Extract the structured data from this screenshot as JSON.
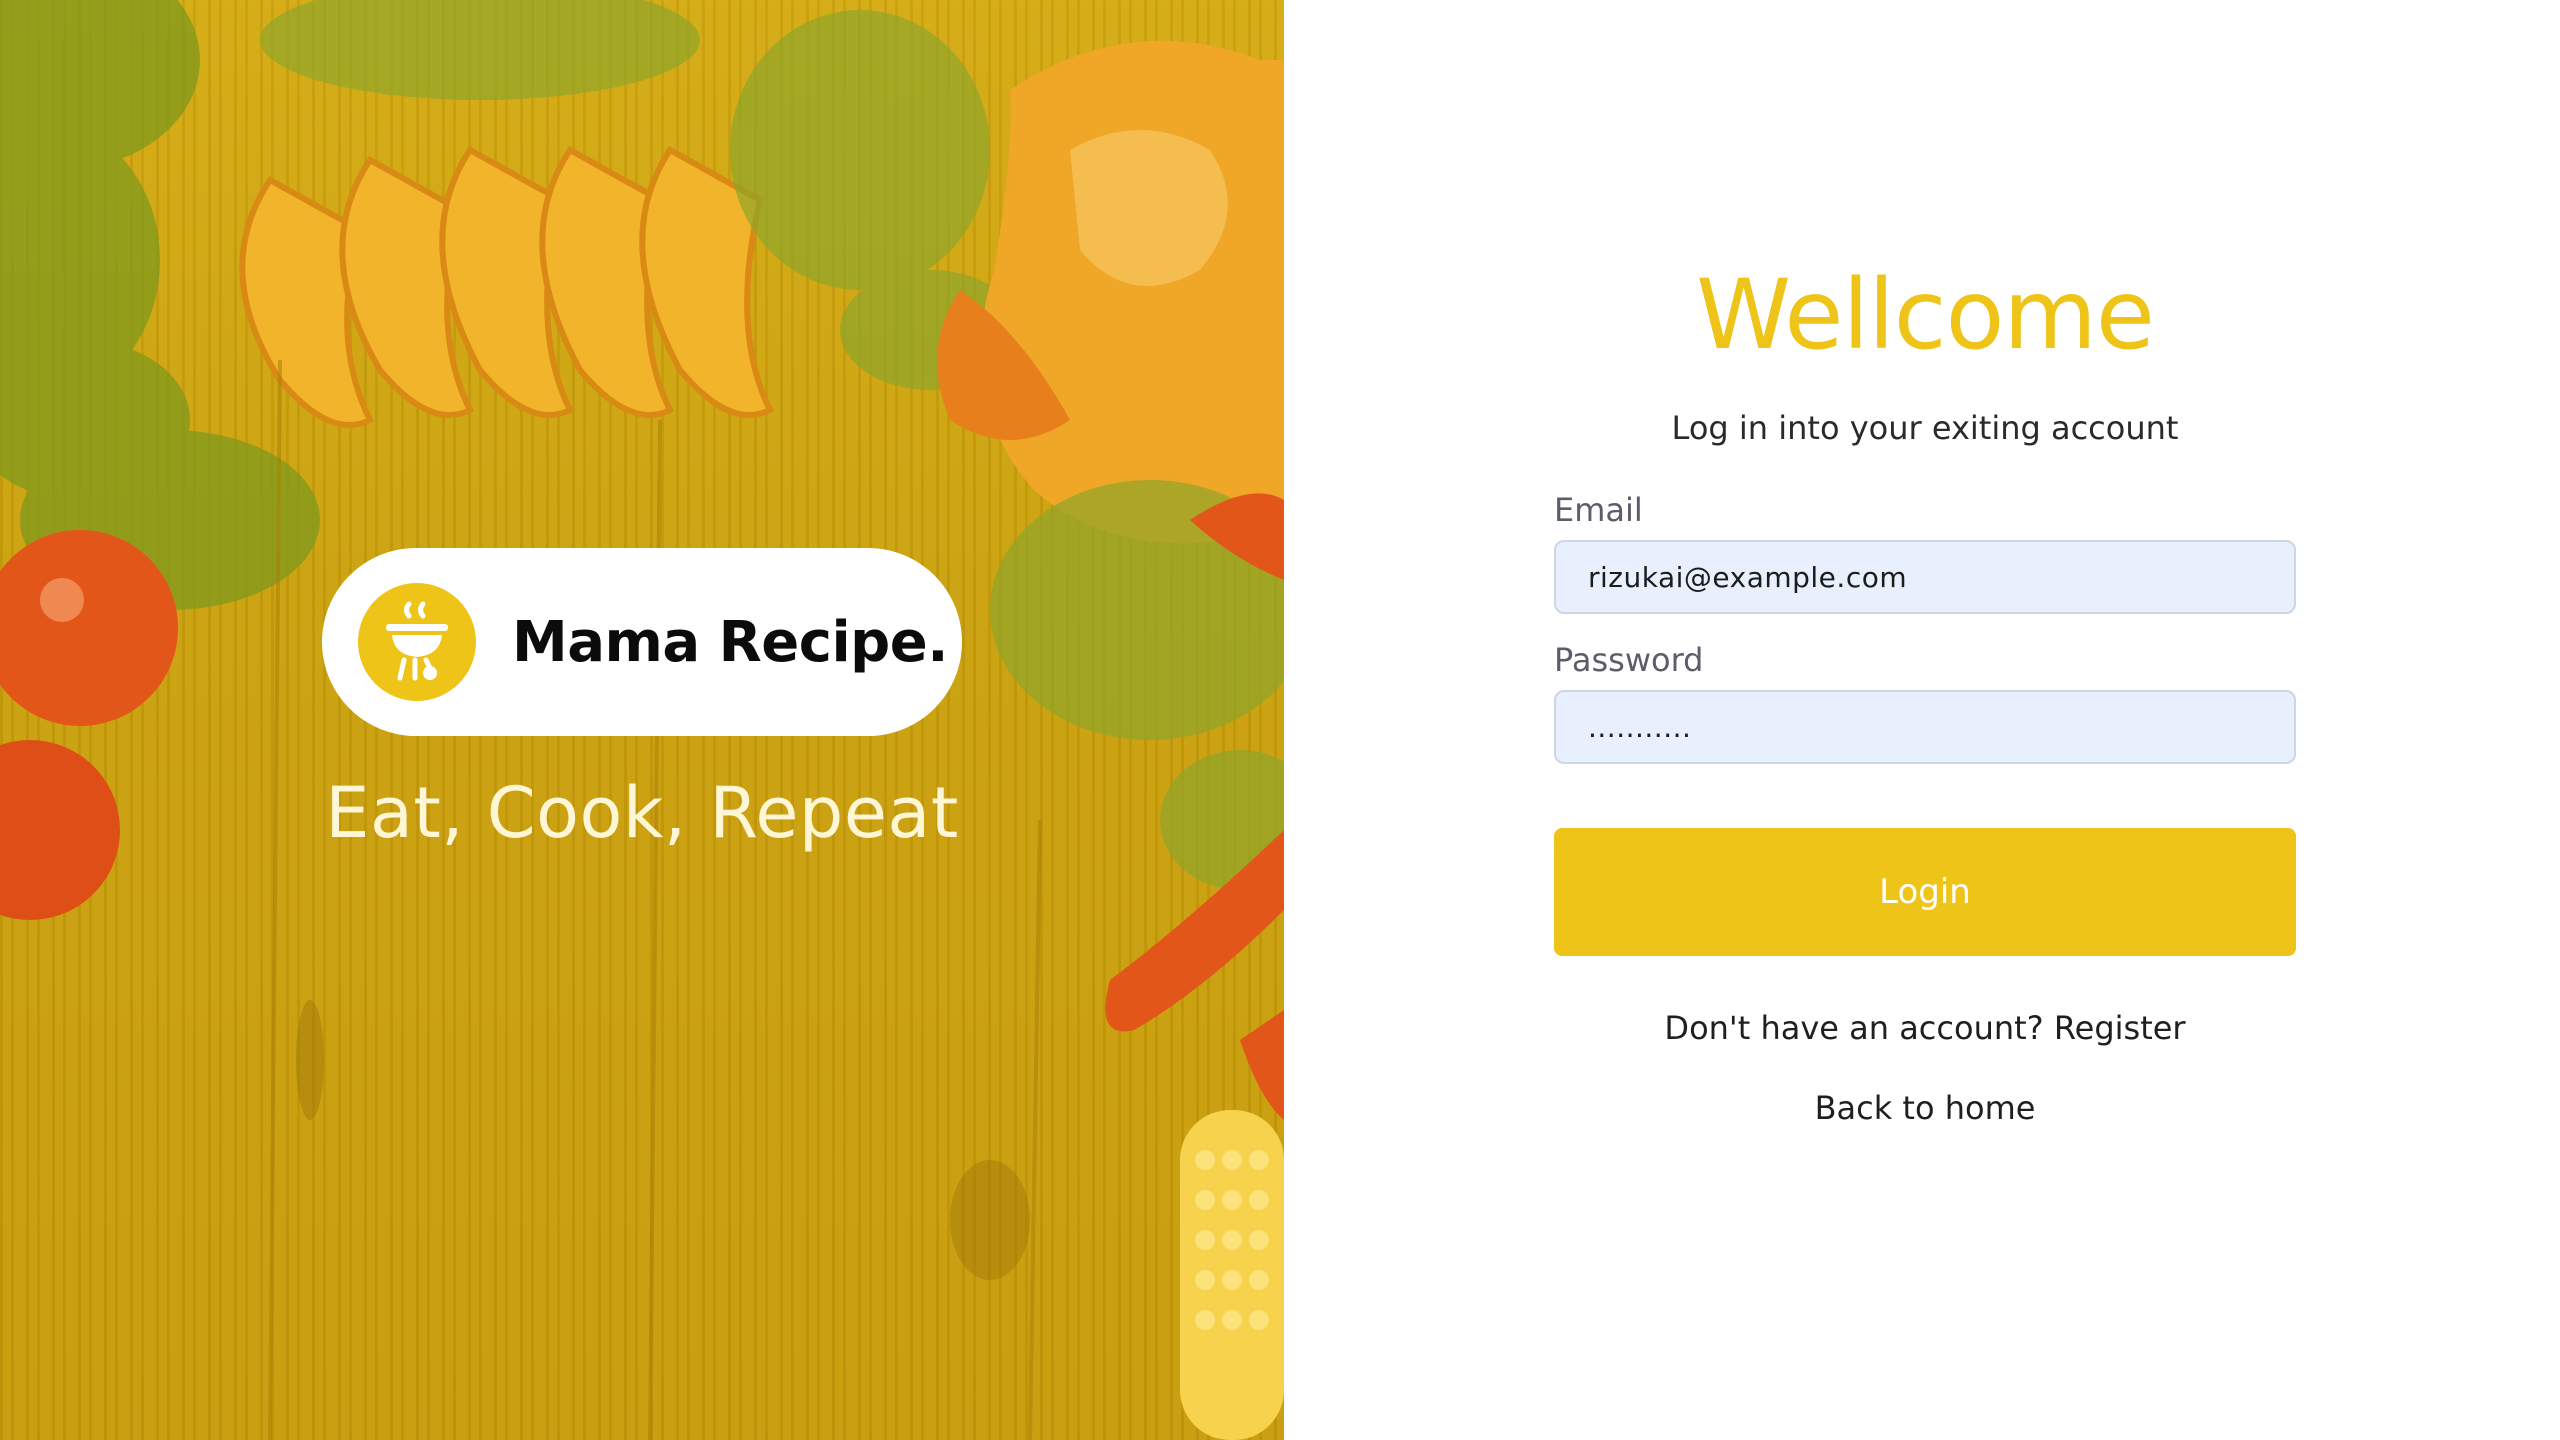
{
  "hero": {
    "brand_name": "Mama Recipe.",
    "brand_logo_icon": "grill-icon",
    "tagline": "Eat, Cook, Repeat"
  },
  "login": {
    "title": "Wellcome",
    "subtitle": "Log in into your exiting account",
    "email": {
      "label": "Email",
      "value": "rizukai@example.com"
    },
    "password": {
      "label": "Password",
      "value": "...........",
      "masked_length": 11
    },
    "submit_label": "Login",
    "register_prompt": "Don't have an account?",
    "register_link": "Register",
    "back_home_label": "Back to home"
  },
  "colors": {
    "accent": "#efc419",
    "input_background": "#e8f0fe",
    "hero_overlay": "#c99f0c"
  }
}
